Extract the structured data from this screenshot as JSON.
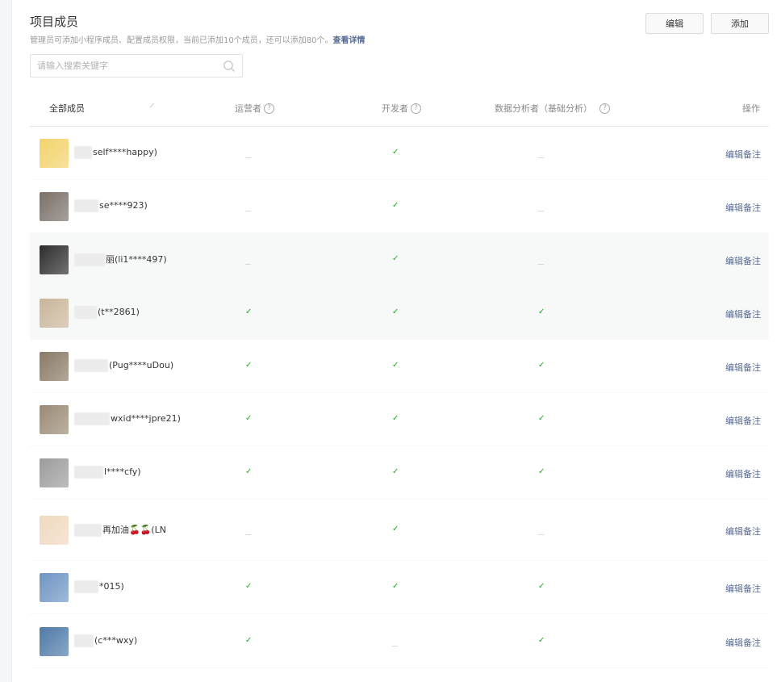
{
  "page": {
    "title": "项目成员",
    "desc": "管理员可添加小程序成员、配置成员权限，当前已添加10个成员，还可以添加80个。",
    "desc_link": "查看详情"
  },
  "toolbar": {
    "edit_label": "编辑",
    "add_label": "添加"
  },
  "search": {
    "placeholder": "请输入搜索关键字"
  },
  "columns": {
    "all": "全部成员",
    "operator": "运营者",
    "developer": "开发者",
    "data_analyst": "数据分析者（基础分析）",
    "action": "操作",
    "help": "?"
  },
  "members": [
    {
      "name": "self****happy)",
      "operator": false,
      "developer": true,
      "data": false,
      "action": "编辑备注",
      "avatar_color": "#f3d36b",
      "avatar_icon": "rabbit-cartoon-avatar"
    },
    {
      "name": "se****923)",
      "operator": false,
      "developer": true,
      "data": false,
      "action": "编辑备注",
      "avatar_color": "#7a7068",
      "avatar_icon": "person-back-avatar"
    },
    {
      "name": "丽(li1****497)",
      "operator": false,
      "developer": true,
      "data": false,
      "action": "编辑备注",
      "avatar_color": "#2c2c2c",
      "avatar_icon": "rabbit-sunglasses-avatar"
    },
    {
      "name": "(t**2861)",
      "operator": true,
      "developer": true,
      "data": true,
      "action": "编辑备注",
      "avatar_color": "#c9b69a",
      "avatar_icon": "dog-avatar"
    },
    {
      "name": "(Pug****uDou)",
      "operator": true,
      "developer": true,
      "data": true,
      "action": "编辑备注",
      "avatar_color": "#8a7a66",
      "avatar_icon": "room-photo-avatar"
    },
    {
      "name": "wxid****jpre21)",
      "operator": true,
      "developer": true,
      "data": true,
      "action": "编辑备注",
      "avatar_color": "#9a8a74",
      "avatar_icon": "person-photo-avatar"
    },
    {
      "name": "l****cfy)",
      "operator": true,
      "developer": true,
      "data": true,
      "action": "编辑备注",
      "avatar_color": "#9c9c9c",
      "avatar_icon": "sketch-portrait-avatar"
    },
    {
      "name": "再加油🍒🍒(LN",
      "operator": false,
      "developer": true,
      "data": false,
      "action": "编辑备注",
      "avatar_color": "#f0d9bf",
      "avatar_icon": "girl-cartoon-avatar"
    },
    {
      "name": "*015)",
      "operator": true,
      "developer": true,
      "data": true,
      "action": "编辑备注",
      "avatar_color": "#6f95c4",
      "avatar_icon": "sky-flag-avatar"
    },
    {
      "name": "(c***wxy)",
      "operator": true,
      "developer": false,
      "data": true,
      "action": "编辑备注",
      "avatar_color": "#4f7aa8",
      "avatar_icon": "sea-landscape-avatar"
    }
  ]
}
